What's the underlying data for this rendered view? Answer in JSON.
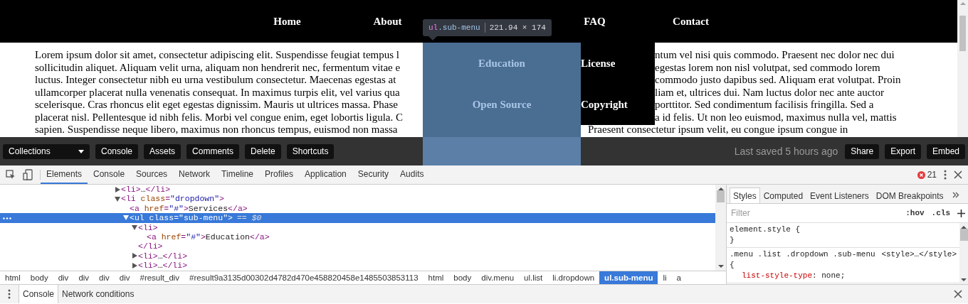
{
  "preview": {
    "nav": [
      {
        "label": "Home"
      },
      {
        "label": "About"
      },
      {
        "label": "FAQ"
      },
      {
        "label": "Contact"
      }
    ],
    "tooltip": {
      "tag": "ul",
      "cls": ".sub-menu",
      "size": "221.94 × 174"
    },
    "submenu": [
      {
        "label": "Education"
      },
      {
        "label": "License"
      },
      {
        "label": "Open Source"
      },
      {
        "label": "Copyright"
      }
    ],
    "text_left": [
      "Lorem ipsum dolor sit amet, consectetur adipiscing elit. Suspendisse feugiat tempus l",
      "sollicitudin aliquet. Aliquam velit urna, aliquam non hendrerit nec, fermentum vitae e",
      "luctus. Integer consectetur nibh eu urna vestibulum consectetur. Maecenas egestas at",
      "ullamcorper placerat nulla venenatis consequat. In maximus turpis elit, vel varius qua",
      "scelerisque. Cras rhoncus elit eget egestas dignissim. Mauris ut ultrices massa. Phase",
      "placerat nisl. Pellentesque id nibh felis. Morbi vel congue enim, eget lobortis ligula. C",
      "sapien. Suspendisse neque libero, maximus non rhoncus tempus, euismod non massa"
    ],
    "text_right": [
      "ntum vel nisi quis commodo. Praesent nec dolor nec dui",
      "egestas lorem non nisl volutpat, sed commodo lorem",
      "commodo justo dapibus sed. Aliquam erat volutpat. Proin",
      "liam et, ultrices dui. Nam luctus dolor nec ante auctor",
      "porttitor. Sed condimentum facilisis fringilla. Sed a",
      "a id felis. Ut non leo euismod, maximus nulla vel, mattis",
      "Praesent consectetur ipsum velit, eu congue ipsum congue in"
    ]
  },
  "toolbar": {
    "collections": "Collections",
    "buttons": [
      "Console",
      "Assets",
      "Comments",
      "Delete",
      "Shortcuts"
    ],
    "saved": "Last saved 5 hours ago",
    "right_buttons": [
      "Share",
      "Export",
      "Embed"
    ]
  },
  "devtools": {
    "tabs": [
      {
        "label": "Elements",
        "selected": true
      },
      {
        "label": "Console",
        "selected": false
      },
      {
        "label": "Sources",
        "selected": false
      },
      {
        "label": "Network",
        "selected": false
      },
      {
        "label": "Timeline",
        "selected": false
      },
      {
        "label": "Profiles",
        "selected": false
      },
      {
        "label": "Application",
        "selected": false
      },
      {
        "label": "Security",
        "selected": false
      },
      {
        "label": "Audits",
        "selected": false
      }
    ],
    "error_count": "21",
    "dom_tree": [
      {
        "markup": "<li>…</li>",
        "expanded": false,
        "selected": false
      },
      {
        "markup": "<li class=\"dropdown\">",
        "expanded": true,
        "selected": false,
        "children": [
          {
            "markup": "<a href=\"#\">Services</a>",
            "selected": false
          },
          {
            "markup": "<ul class=\"sub-menu\">",
            "suffix": "== $0",
            "expanded": true,
            "selected": true,
            "children": [
              {
                "markup": "<li>",
                "expanded": true,
                "selected": false,
                "closing": "</li>",
                "children": [
                  {
                    "markup": "<a href=\"#\">Education</a>",
                    "selected": false
                  }
                ]
              },
              {
                "markup": "<li>…</li>",
                "expanded": false,
                "selected": false
              },
              {
                "markup": "<li>…</li>",
                "expanded": false,
                "selected": false
              }
            ]
          }
        ]
      }
    ],
    "breadcrumbs": [
      {
        "label": "html",
        "selected": false
      },
      {
        "label": "body",
        "selected": false
      },
      {
        "label": "div",
        "selected": false
      },
      {
        "label": "div",
        "selected": false
      },
      {
        "label": "div",
        "selected": false
      },
      {
        "label": "div",
        "selected": false
      },
      {
        "label": "#result_div",
        "selected": false
      },
      {
        "label": "#result9a3135d00302d4782d470e458820458e1485503853113",
        "selected": false
      },
      {
        "label": "html",
        "selected": false
      },
      {
        "label": "body",
        "selected": false
      },
      {
        "label": "div.menu",
        "selected": false
      },
      {
        "label": "ul.list",
        "selected": false
      },
      {
        "label": "li.dropdown",
        "selected": false
      },
      {
        "label": "ul.sub-menu",
        "selected": true
      },
      {
        "label": "li",
        "selected": false
      },
      {
        "label": "a",
        "selected": false
      }
    ],
    "styles_tabs": [
      {
        "label": "Styles",
        "selected": true
      },
      {
        "label": "Computed",
        "selected": false
      },
      {
        "label": "Event Listeners",
        "selected": false
      },
      {
        "label": "DOM Breakpoints",
        "selected": false
      }
    ],
    "filter": {
      "placeholder": "Filter"
    },
    "hov": ":hov",
    "cls": ".cls",
    "rules": [
      {
        "selector": "element.style",
        "open": "{",
        "close": "}"
      },
      {
        "selector": ".menu .list .dropdown .sub-menu",
        "source": "<style>…</style>",
        "open": "{",
        "declarations": [
          "list-style-type: none;"
        ]
      }
    ],
    "drawer_tabs": [
      {
        "label": "Console",
        "selected": true
      },
      {
        "label": "Network conditions",
        "selected": false
      }
    ]
  }
}
